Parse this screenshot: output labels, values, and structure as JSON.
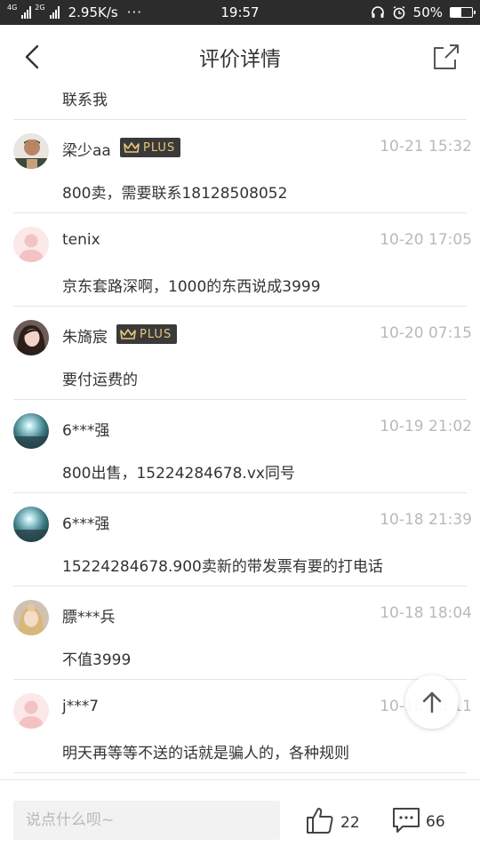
{
  "status_bar": {
    "network_1": "4G",
    "network_2": "2G",
    "speed": "2.95K/s",
    "more": "···",
    "time": "19:57",
    "battery": "50%",
    "battery_level": 0.5
  },
  "header": {
    "title": "评价详情"
  },
  "previous_comment_text": "联系我",
  "comments": [
    {
      "user": "梁少aa",
      "plus": "PLUS",
      "time": "10-21 15:32",
      "text": "800卖，需要联系18128508052"
    },
    {
      "user": "tenix",
      "time": "10-20 17:05",
      "text": "京东套路深啊，1000的东西说成3999"
    },
    {
      "user": "朱旖宸",
      "plus": "PLUS",
      "time": "10-20 07:15",
      "text": "要付运费的"
    },
    {
      "user": "6***强",
      "time": "10-19 21:02",
      "text": "800出售，15224284678.vx同号"
    },
    {
      "user": "6***强",
      "time": "10-18 21:39",
      "text": "15224284678.900卖新的带发票有要的打电话"
    },
    {
      "user": "膘***兵",
      "time": "10-18 18:04",
      "text": "不值3999"
    },
    {
      "user": "j***7",
      "time": "10-18 16:11",
      "text": "明天再等等不送的话就是骗人的，各种规则"
    }
  ],
  "bottom_bar": {
    "input_placeholder": "说点什么呗~",
    "like_count": "22",
    "reply_count": "66"
  },
  "colors": {
    "status_bar_bg": "#2c2c2c",
    "plus_badge_bg": "#3a3a3a",
    "plus_badge_text": "#e8c77a",
    "timestamp": "#b9b9b9",
    "divider": "#e5e5e5"
  },
  "icons": {
    "back": "chevron-left-icon",
    "share": "share-icon",
    "plus": "crown-icon",
    "scroll_top": "arrow-up-icon",
    "like": "thumbs-up-icon",
    "reply": "chat-bubble-icon"
  }
}
